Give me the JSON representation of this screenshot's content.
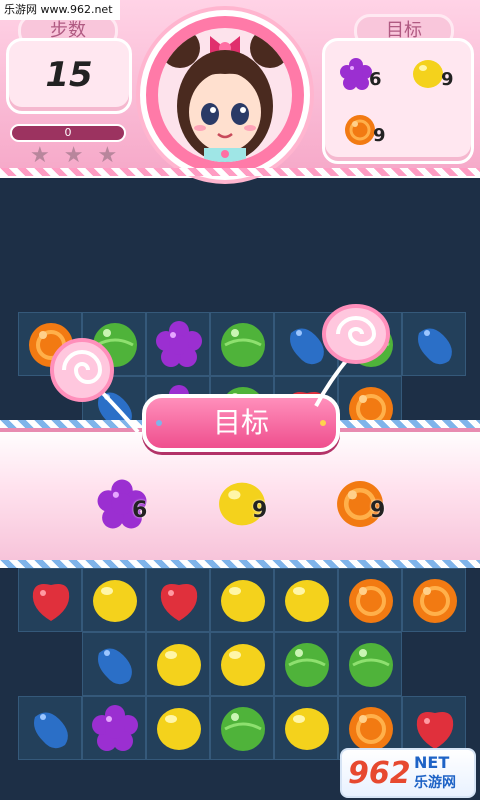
{
  "watermark": "乐游网 www.962.net",
  "hud": {
    "steps_label": "步数",
    "steps_value": "15",
    "score_value": "0",
    "stars_earned": 0,
    "stars_total": 3,
    "goal_label": "目标",
    "goals": [
      {
        "candy": "purple-flower-candy",
        "count": "6"
      },
      {
        "candy": "yellow-lemon-candy",
        "count": "9"
      },
      {
        "candy": "orange-round-candy",
        "count": "9"
      }
    ]
  },
  "banner": {
    "title": "目标",
    "goals": [
      {
        "candy": "purple-flower-candy",
        "count": "6"
      },
      {
        "candy": "yellow-lemon-candy",
        "count": "9"
      },
      {
        "candy": "orange-round-candy",
        "count": "9"
      }
    ]
  },
  "board": {
    "rows_top": [
      [
        "orange",
        "green",
        "purple",
        "green",
        "blue",
        "green",
        "blue"
      ],
      [
        "",
        "blue",
        "purple",
        "green",
        "red",
        "orange",
        ""
      ]
    ],
    "rows_bottom": [
      [
        "red",
        "yellow",
        "red",
        "yellow",
        "yellow",
        "orange",
        "orange"
      ],
      [
        "",
        "blue",
        "yellow",
        "yellow",
        "green",
        "green",
        ""
      ],
      [
        "blue",
        "purple",
        "yellow",
        "green",
        "yellow",
        "orange",
        "red"
      ]
    ]
  },
  "colors": {
    "purple": "#9b2fd1",
    "yellow": "#f4d21c",
    "orange": "#f27a12",
    "green": "#4fb33a",
    "blue": "#2b6fc7",
    "red": "#e0303c",
    "pink_accent": "#ef4f8e"
  },
  "logo": {
    "big": "962",
    "net": "NET",
    "cn": "乐游网"
  }
}
